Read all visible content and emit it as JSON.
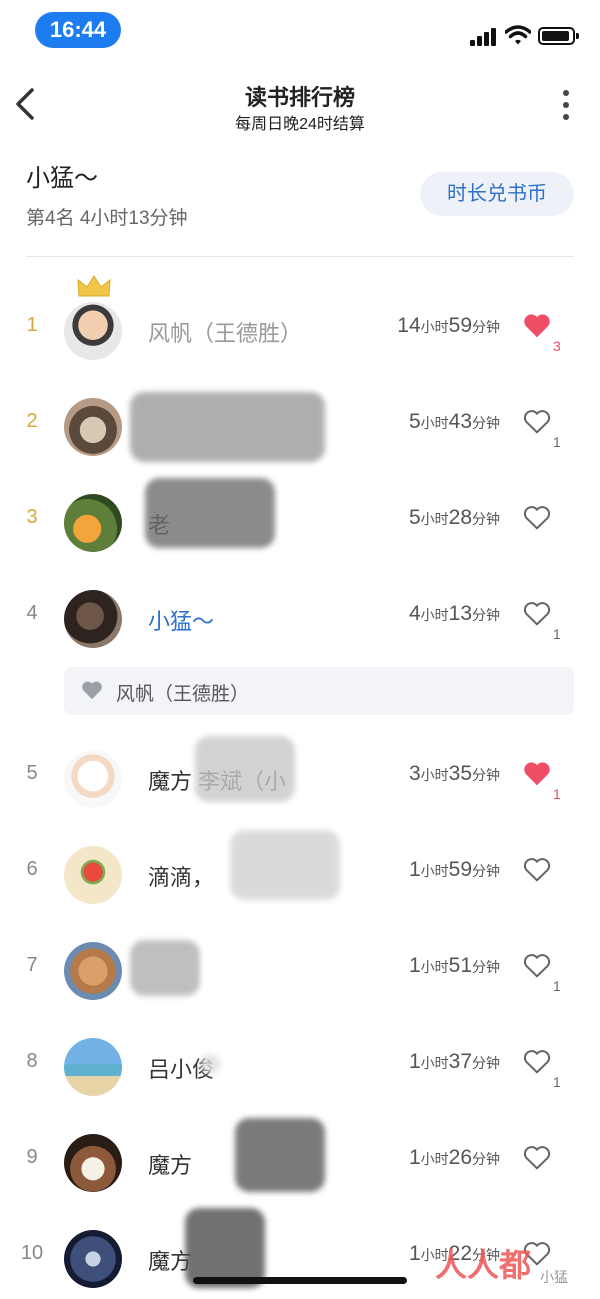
{
  "status": {
    "time": "16:44"
  },
  "nav": {
    "title": "读书排行榜",
    "subtitle": "每周日晚24时结算"
  },
  "me": {
    "name": "小猛～",
    "rank_text": "第4名  4小时13分钟",
    "exchange_button": "时长兑书币"
  },
  "rows": [
    {
      "rank": "1",
      "name": "风帆（王德胜）",
      "hours": "14",
      "hour_unit": "小时",
      "minutes": "59",
      "minute_unit": "分钟",
      "liked": true,
      "likes": "3"
    },
    {
      "rank": "2",
      "name": "",
      "hours": "5",
      "hour_unit": "小时",
      "minutes": "43",
      "minute_unit": "分钟",
      "liked": false,
      "likes": "1"
    },
    {
      "rank": "3",
      "name": "老",
      "hours": "5",
      "hour_unit": "小时",
      "minutes": "28",
      "minute_unit": "分钟",
      "liked": false,
      "likes": ""
    },
    {
      "rank": "4",
      "name": "小猛～",
      "hours": "4",
      "hour_unit": "小时",
      "minutes": "13",
      "minute_unit": "分钟",
      "liked": false,
      "likes": "1"
    },
    {
      "rank": "5",
      "name": "魔方  李斌（小",
      "hours": "3",
      "hour_unit": "小时",
      "minutes": "35",
      "minute_unit": "分钟",
      "liked": true,
      "likes": "1"
    },
    {
      "rank": "6",
      "name": "滴滴，",
      "hours": "1",
      "hour_unit": "小时",
      "minutes": "59",
      "minute_unit": "分钟",
      "liked": false,
      "likes": ""
    },
    {
      "rank": "7",
      "name": "",
      "hours": "1",
      "hour_unit": "小时",
      "minutes": "51",
      "minute_unit": "分钟",
      "liked": false,
      "likes": "1"
    },
    {
      "rank": "8",
      "name": "吕小俊",
      "hours": "1",
      "hour_unit": "小时",
      "minutes": "37",
      "minute_unit": "分钟",
      "liked": false,
      "likes": "1"
    },
    {
      "rank": "9",
      "name": "魔方",
      "hours": "1",
      "hour_unit": "小时",
      "minutes": "26",
      "minute_unit": "分钟",
      "liked": false,
      "likes": ""
    },
    {
      "rank": "10",
      "name": "魔方",
      "hours": "1",
      "hour_unit": "小时",
      "minutes": "22",
      "minute_unit": "分钟",
      "liked": false,
      "likes": ""
    }
  ],
  "likers": {
    "text": "风帆（王德胜）"
  },
  "watermark": {
    "text": "人人都",
    "sub": "小猛"
  },
  "colors": {
    "accent": "#2f71c8",
    "gold": "#d5a83b",
    "like_red": "#f04d67",
    "time_pill": "#1c7cf0"
  },
  "icons": {
    "back": "chevron-left-icon",
    "more": "more-vertical-icon",
    "like_on": "heart-filled-icon",
    "like_off": "heart-outline-icon",
    "crown": "crown-icon"
  }
}
